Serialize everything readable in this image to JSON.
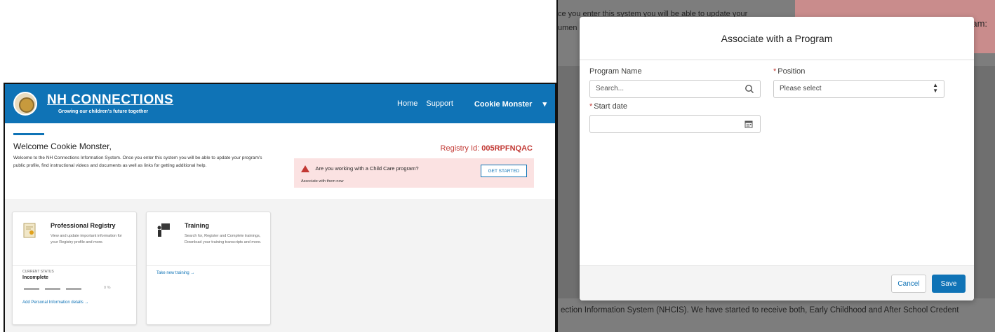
{
  "header": {
    "brand_title": "NH CONNECTIONS",
    "brand_tagline": "Growing our children's future together",
    "nav": [
      "Home",
      "Support"
    ],
    "user_name": "Cookie Monster"
  },
  "welcome": {
    "heading": "Welcome Cookie Monster,",
    "body": "Welcome to the NH Connections Information System. Once you enter this system you will be able to update your program's public profile, find instructional videos and documents as well as links for getting additional help.",
    "registry_label": "Registry Id:",
    "registry_id": "005RPFNQAC"
  },
  "alert": {
    "question": "Are you working with a Child Care program?",
    "sub": "Associate with them now",
    "button": "GET STARTED"
  },
  "cards": {
    "registry": {
      "title": "Professional Registry",
      "desc": "View and update important information for your Registry profile and more.",
      "status_label": "CURRENT STATUS",
      "status": "Incomplete",
      "progress_percent": 0,
      "progress_text": "0 %",
      "link": "Add Personal Information details →"
    },
    "training": {
      "title": "Training",
      "desc": "Search for, Register and Complete trainings, Download your training transcripts and more.",
      "link": "Take new training →"
    }
  },
  "background": {
    "line1": "ce you enter this system you will be able to update your",
    "line2": "umen",
    "right_fragment": "program:",
    "footer": "ection Information System (NHCIS). We have started to receive both, Early Childhood and After School Credent"
  },
  "modal": {
    "title": "Associate with a Program",
    "program_label": "Program Name",
    "program_placeholder": "Search...",
    "position_label": "Position",
    "position_value": "Please select",
    "start_label": "Start date",
    "required_mark": "*",
    "cancel": "Cancel",
    "save": "Save"
  },
  "colors": {
    "brand_blue": "#0f73b6",
    "alert_red": "#c23934",
    "alert_bg": "#fbe2e2"
  },
  "icons": [
    "seal-logo",
    "chevron-down-icon",
    "warning-icon",
    "certificate-icon",
    "teacher-icon",
    "search-icon",
    "calendar-icon",
    "select-arrows-icon"
  ]
}
